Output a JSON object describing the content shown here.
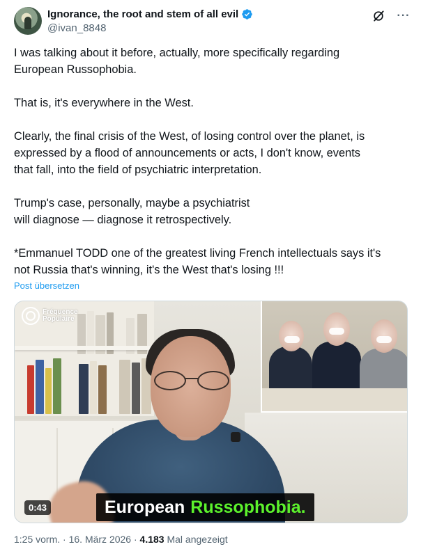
{
  "author": {
    "display_name": "Ignorance, the root and stem of all evil",
    "handle": "@ivan_8848",
    "verified": true,
    "verified_color": "#1d9bf0"
  },
  "header_icons": [
    "grok-icon",
    "more-icon"
  ],
  "body": {
    "paragraphs": [
      [
        "I was talking about it before, actually, more specifically regarding",
        "European Russophobia."
      ],
      [
        "That is, it's everywhere in the West."
      ],
      [
        "Clearly, the final crisis of the West, of losing control over the planet, is",
        "expressed by a flood of announcements or acts, I don't know, events",
        "that fall, into the field of psychiatric interpretation."
      ],
      [
        "Trump's case, personally, maybe a psychiatrist",
        "will diagnose — diagnose it retrospectively."
      ],
      [
        "*Emmanuel TODD one of the greatest living French intellectuals says it's",
        "not Russia that's winning, it's the West that's losing !!!"
      ]
    ]
  },
  "translate_label": "Post übersetzen",
  "media": {
    "logo_line1": "Fréquence",
    "logo_line2": "Populaire",
    "duration": "0:43",
    "caption_white": "European",
    "caption_green": "Russophobia.",
    "caption_green_color": "#5cf22c"
  },
  "meta": {
    "time": "1:25 vorm.",
    "sep1": "·",
    "date": "16. März 2026",
    "sep2": "·",
    "views": "4.183",
    "views_label": "Mal angezeigt"
  },
  "colors": {
    "link": "#1d9bf0",
    "text": "#0f1419",
    "secondary": "#536471"
  }
}
